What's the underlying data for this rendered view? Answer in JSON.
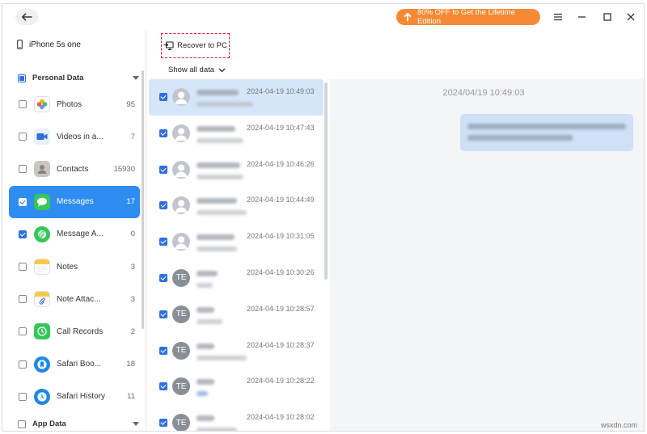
{
  "titlebar": {
    "promo_label": "80% OFF to Get the Lifetime Edition",
    "accent": "#f58a35"
  },
  "sidebar": {
    "device_name": "iPhone 5s one",
    "personal_section": "Personal Data",
    "app_section": "App Data",
    "items": [
      {
        "label": "Photos",
        "count": "95",
        "checked": false,
        "icon": "photos-icon"
      },
      {
        "label": "Videos in a...",
        "count": "7",
        "checked": false,
        "icon": "videos-icon"
      },
      {
        "label": "Contacts",
        "count": "15930",
        "checked": false,
        "icon": "contacts-icon"
      },
      {
        "label": "Messages",
        "count": "17",
        "checked": true,
        "icon": "messages-icon"
      },
      {
        "label": "Message A...",
        "count": "0",
        "checked": true,
        "icon": "message-attachments-icon"
      },
      {
        "label": "Notes",
        "count": "3",
        "checked": false,
        "icon": "notes-icon"
      },
      {
        "label": "Note Attac...",
        "count": "3",
        "checked": false,
        "icon": "note-attachments-icon"
      },
      {
        "label": "Call Records",
        "count": "2",
        "checked": false,
        "icon": "call-records-icon"
      },
      {
        "label": "Safari Boo...",
        "count": "18",
        "checked": false,
        "icon": "safari-bookmarks-icon"
      },
      {
        "label": "Safari History",
        "count": "11",
        "checked": false,
        "icon": "safari-history-icon"
      }
    ]
  },
  "toolbar": {
    "recover_label": "Recover to PC",
    "filter_label": "Show all data"
  },
  "messages": [
    {
      "time": "2024-04-19 10:49:03",
      "avatar": "",
      "selected": true
    },
    {
      "time": "2024-04-19 10:47:43",
      "avatar": "",
      "selected": false
    },
    {
      "time": "2024-04-19 10:46:26",
      "avatar": "",
      "selected": false
    },
    {
      "time": "2024-04-19 10:44:49",
      "avatar": "",
      "selected": false
    },
    {
      "time": "2024-04-19 10:31:05",
      "avatar": "",
      "selected": false
    },
    {
      "time": "2024-04-19 10:30:26",
      "avatar": "TE",
      "selected": false
    },
    {
      "time": "2024-04-19 10:28:57",
      "avatar": "TE",
      "selected": false
    },
    {
      "time": "2024-04-19 10:28:37",
      "avatar": "TE",
      "selected": false
    },
    {
      "time": "2024-04-19 10:28:22",
      "avatar": "TE",
      "selected": false
    },
    {
      "time": "2024-04-19 10:28:02",
      "avatar": "TE",
      "selected": false
    }
  ],
  "detail": {
    "timestamp": "2024/04/19 10:49:03"
  },
  "watermark": "wsxdn.com"
}
